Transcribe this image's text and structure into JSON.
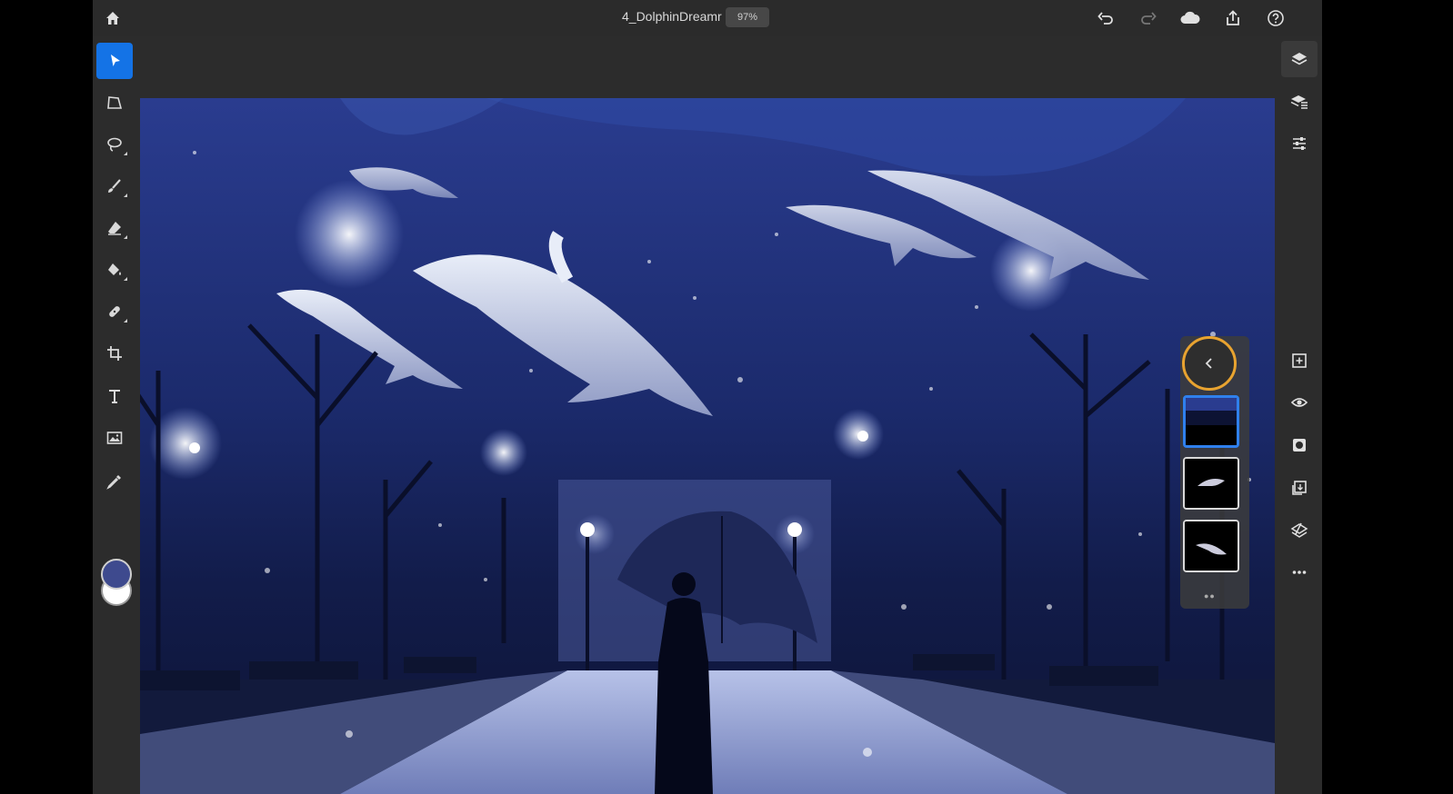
{
  "document": {
    "title": "4_DolphinDreamr",
    "zoom": "97%"
  },
  "topbar": {
    "icons": [
      "home-icon",
      "undo-icon",
      "redo-icon",
      "cloud-icon",
      "share-icon",
      "help-icon"
    ]
  },
  "left_toolbar": {
    "tools": [
      "select-icon",
      "transform-icon",
      "lasso-icon",
      "brush-icon",
      "eraser-icon",
      "fill-icon",
      "healing-icon",
      "crop-icon",
      "type-icon",
      "place-image-icon",
      "eyedropper-icon"
    ],
    "active_tool": "select-icon",
    "foreground_color": "#3e4a8e",
    "background_color": "#ffffff"
  },
  "right_toolbar": {
    "tools": [
      "layers-icon",
      "layer-properties-icon",
      "adjustments-icon",
      "add-layer-icon",
      "visibility-icon",
      "mask-icon",
      "reorder-icon",
      "clear-layer-icon",
      "more-icon"
    ],
    "active_tool": "layers-icon"
  },
  "layers_panel": {
    "layers": [
      "background-layer",
      "dolphin-layer",
      "dolphin-layer-2"
    ],
    "selected_layer": "background-layer",
    "highlight_color": "#e8a330",
    "page_indicator": "●●"
  },
  "canvas": {
    "sky_color": "#1b2a6b",
    "accent_color": "#1473e6"
  }
}
